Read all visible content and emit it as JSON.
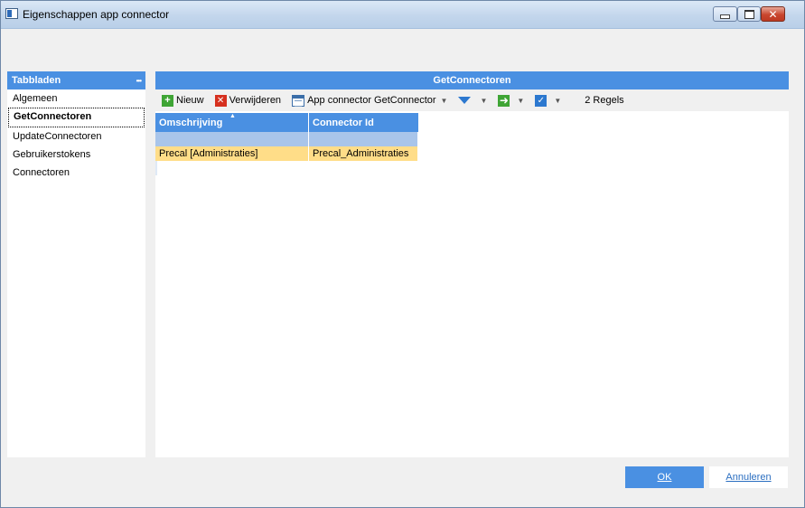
{
  "window": {
    "title": "Eigenschappen app connector",
    "close_glyph": "✕"
  },
  "tabs": {
    "header": "Tabbladen",
    "menu_glyph": "•••",
    "items": [
      {
        "label": "Algemeen"
      },
      {
        "label": "GetConnectoren",
        "active": true
      },
      {
        "label": "UpdateConnectoren"
      },
      {
        "label": "Gebruikerstokens"
      },
      {
        "label": "Connectoren"
      }
    ]
  },
  "main": {
    "header": "GetConnectoren",
    "toolbar": {
      "new_label": "Nieuw",
      "delete_label": "Verwijderen",
      "app_connector_label": "App connector GetConnector",
      "rules_count": "2 Regels",
      "icons": [
        "plus-icon",
        "delete-icon",
        "list-icon",
        "filter-icon",
        "arrow-right-icon",
        "checkbox-icon"
      ]
    },
    "grid": {
      "columns": [
        "Omschrijving",
        "Connector Id"
      ],
      "sort_column": "Omschrijving",
      "sort_glyph": "▲",
      "rows": [
        [
          "Precal [Administraties]",
          "Precal_Administraties"
        ]
      ]
    }
  },
  "footer": {
    "ok_label": "OK",
    "cancel_label": "Annuleren"
  },
  "colors": {
    "accent": "#4a90e2",
    "selected_row": "#ffdd88",
    "filter_row": "#a9c5ea"
  }
}
